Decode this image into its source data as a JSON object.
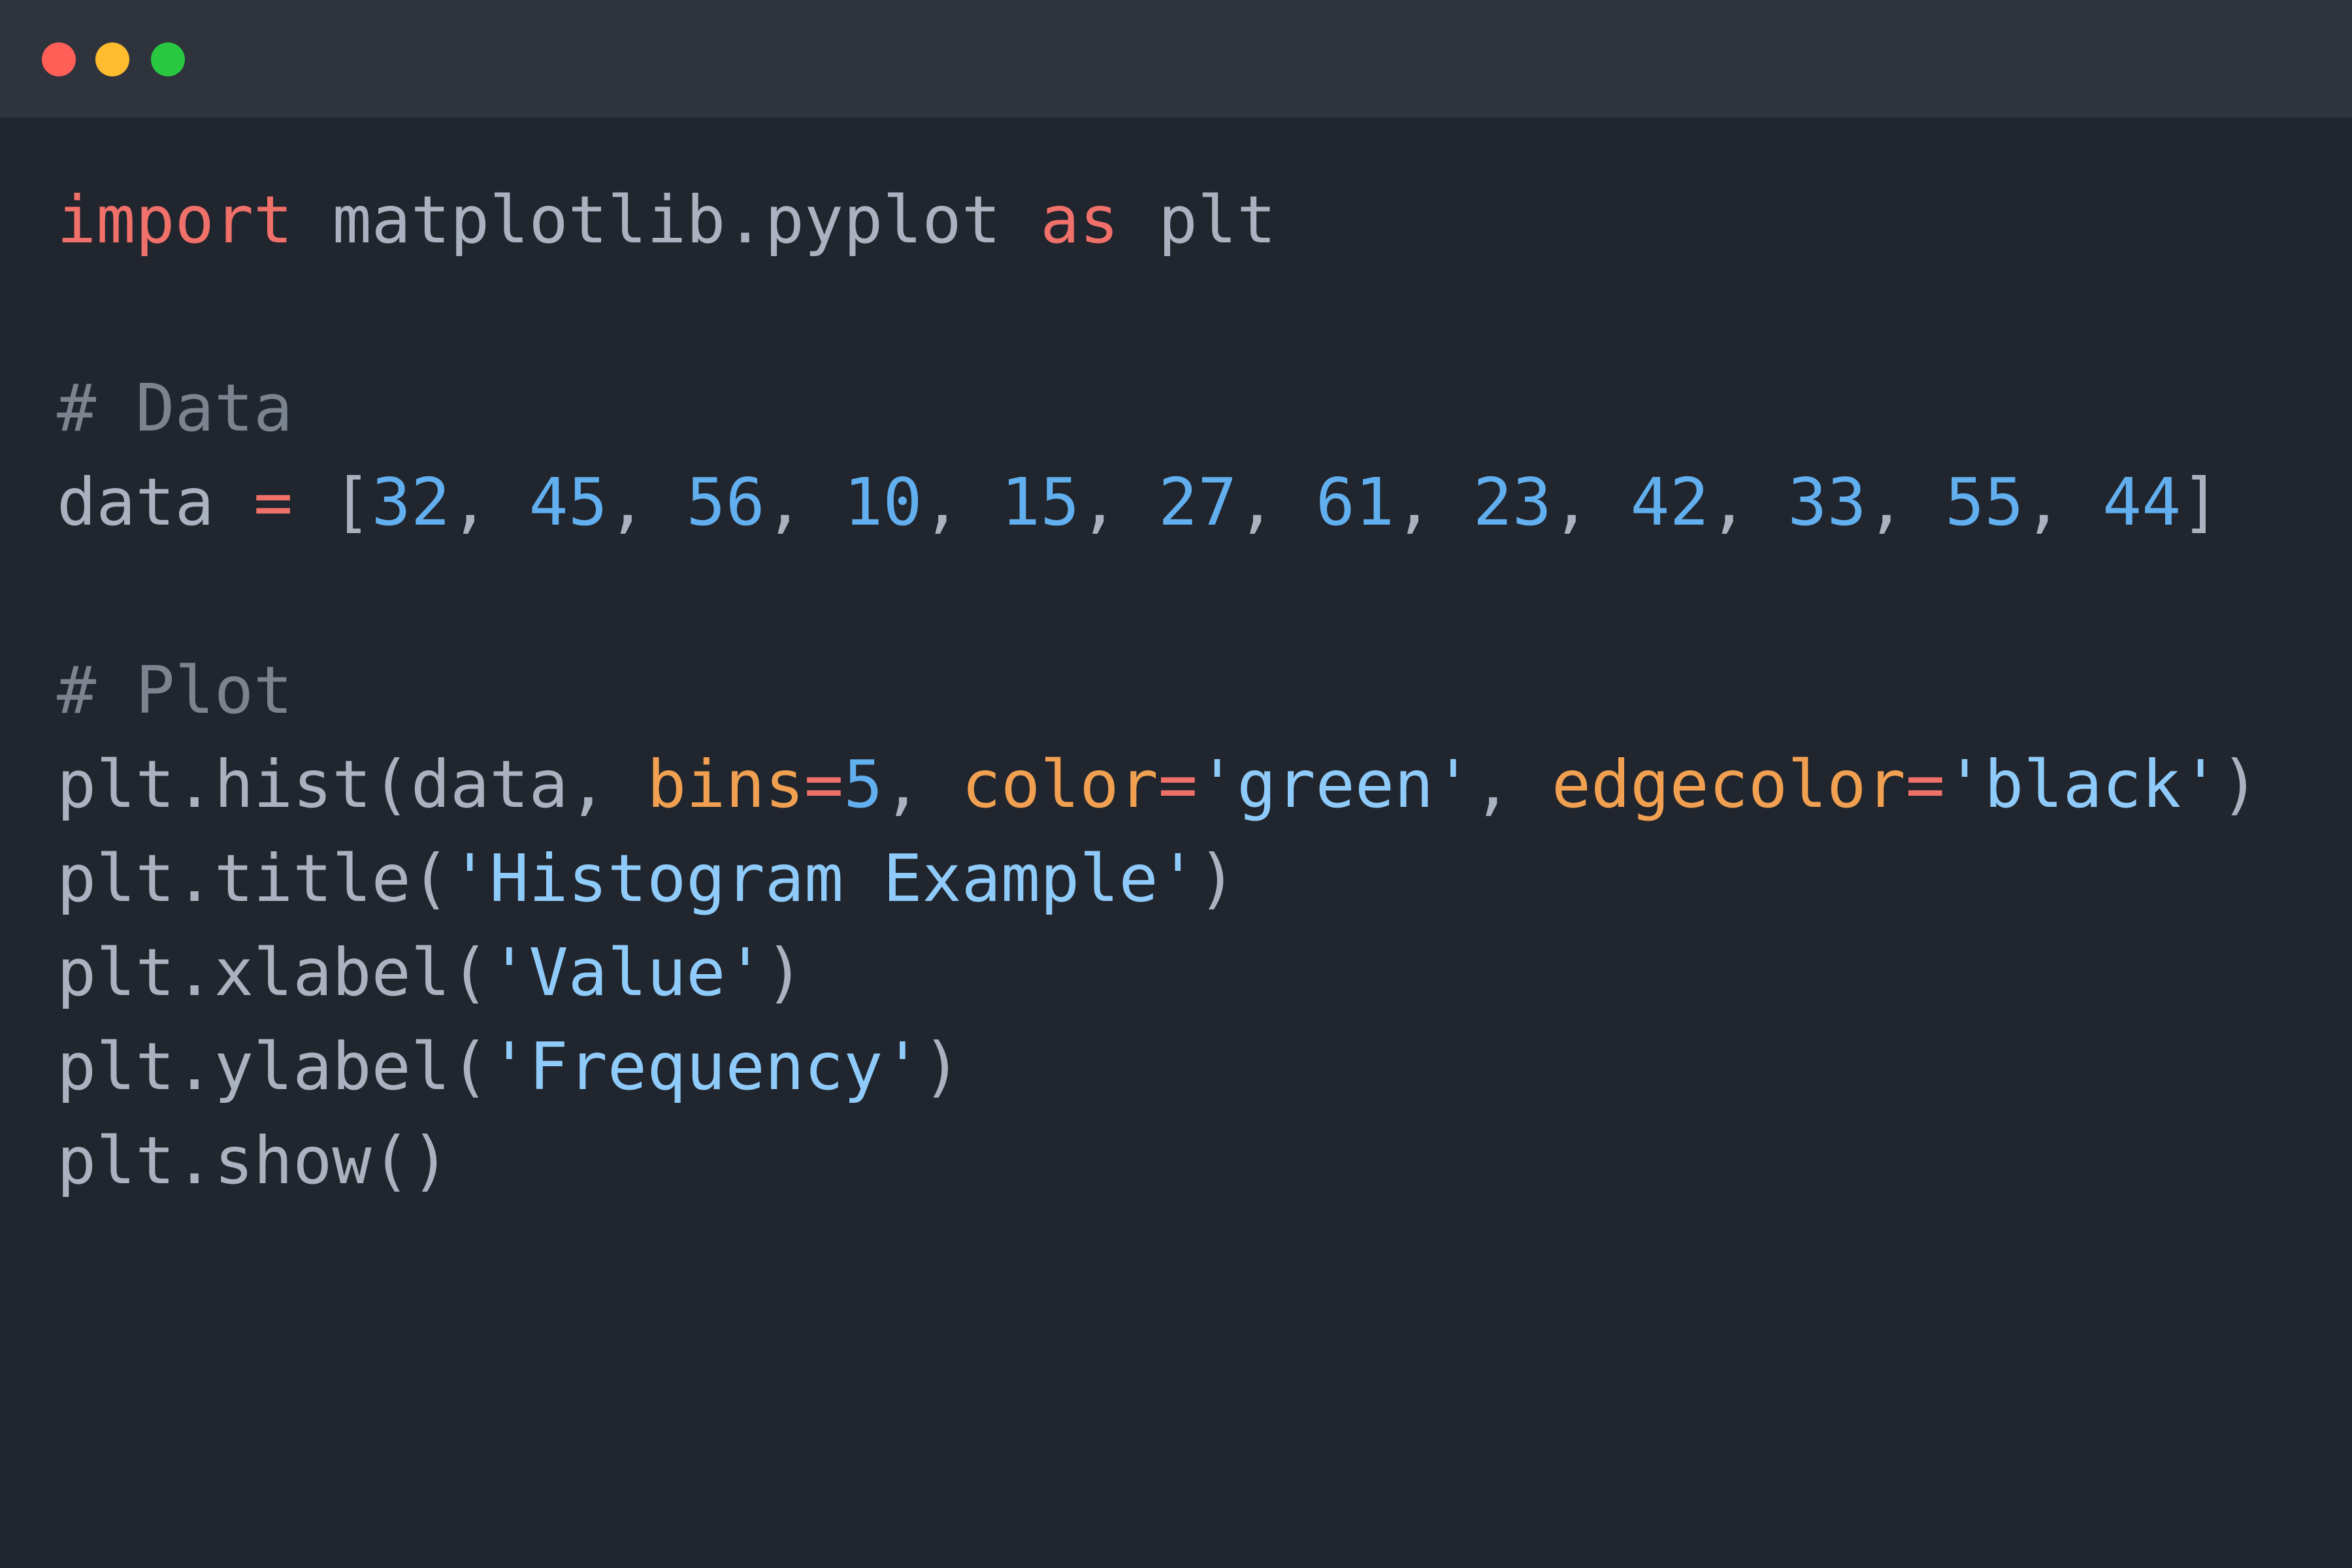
{
  "window": {
    "controls": [
      {
        "name": "close",
        "color": "#ff5f57"
      },
      {
        "name": "minimize",
        "color": "#febc2e"
      },
      {
        "name": "maximize",
        "color": "#28c840"
      }
    ]
  },
  "code": {
    "lines": [
      [
        [
          "kw",
          "import"
        ],
        [
          "plain",
          " matplotlib.pyplot "
        ],
        [
          "kw",
          "as"
        ],
        [
          "plain",
          " plt"
        ]
      ],
      [],
      [
        [
          "comment",
          "# Data"
        ]
      ],
      [
        [
          "plain",
          "data "
        ],
        [
          "op",
          "="
        ],
        [
          "plain",
          " ["
        ],
        [
          "num",
          "32"
        ],
        [
          "plain",
          ", "
        ],
        [
          "num",
          "45"
        ],
        [
          "plain",
          ", "
        ],
        [
          "num",
          "56"
        ],
        [
          "plain",
          ", "
        ],
        [
          "num",
          "10"
        ],
        [
          "plain",
          ", "
        ],
        [
          "num",
          "15"
        ],
        [
          "plain",
          ", "
        ],
        [
          "num",
          "27"
        ],
        [
          "plain",
          ", "
        ],
        [
          "num",
          "61"
        ],
        [
          "plain",
          ", "
        ],
        [
          "num",
          "23"
        ],
        [
          "plain",
          ", "
        ],
        [
          "num",
          "42"
        ],
        [
          "plain",
          ", "
        ],
        [
          "num",
          "33"
        ],
        [
          "plain",
          ", "
        ],
        [
          "num",
          "55"
        ],
        [
          "plain",
          ", "
        ],
        [
          "num",
          "44"
        ],
        [
          "plain",
          "]"
        ]
      ],
      [],
      [
        [
          "comment",
          "# Plot"
        ]
      ],
      [
        [
          "plain",
          "plt.hist(data, "
        ],
        [
          "arg",
          "bins"
        ],
        [
          "op",
          "="
        ],
        [
          "num",
          "5"
        ],
        [
          "plain",
          ", "
        ],
        [
          "arg",
          "color"
        ],
        [
          "op",
          "="
        ],
        [
          "str",
          "'green'"
        ],
        [
          "plain",
          ", "
        ],
        [
          "arg",
          "edgecolor"
        ],
        [
          "op",
          "="
        ],
        [
          "str",
          "'black'"
        ],
        [
          "plain",
          ")"
        ]
      ],
      [
        [
          "plain",
          "plt.title("
        ],
        [
          "str",
          "'Histogram Example'"
        ],
        [
          "plain",
          ")"
        ]
      ],
      [
        [
          "plain",
          "plt.xlabel("
        ],
        [
          "str",
          "'Value'"
        ],
        [
          "plain",
          ")"
        ]
      ],
      [
        [
          "plain",
          "plt.ylabel("
        ],
        [
          "str",
          "'Frequency'"
        ],
        [
          "plain",
          ")"
        ]
      ],
      [
        [
          "plain",
          "plt.show()"
        ]
      ]
    ]
  }
}
